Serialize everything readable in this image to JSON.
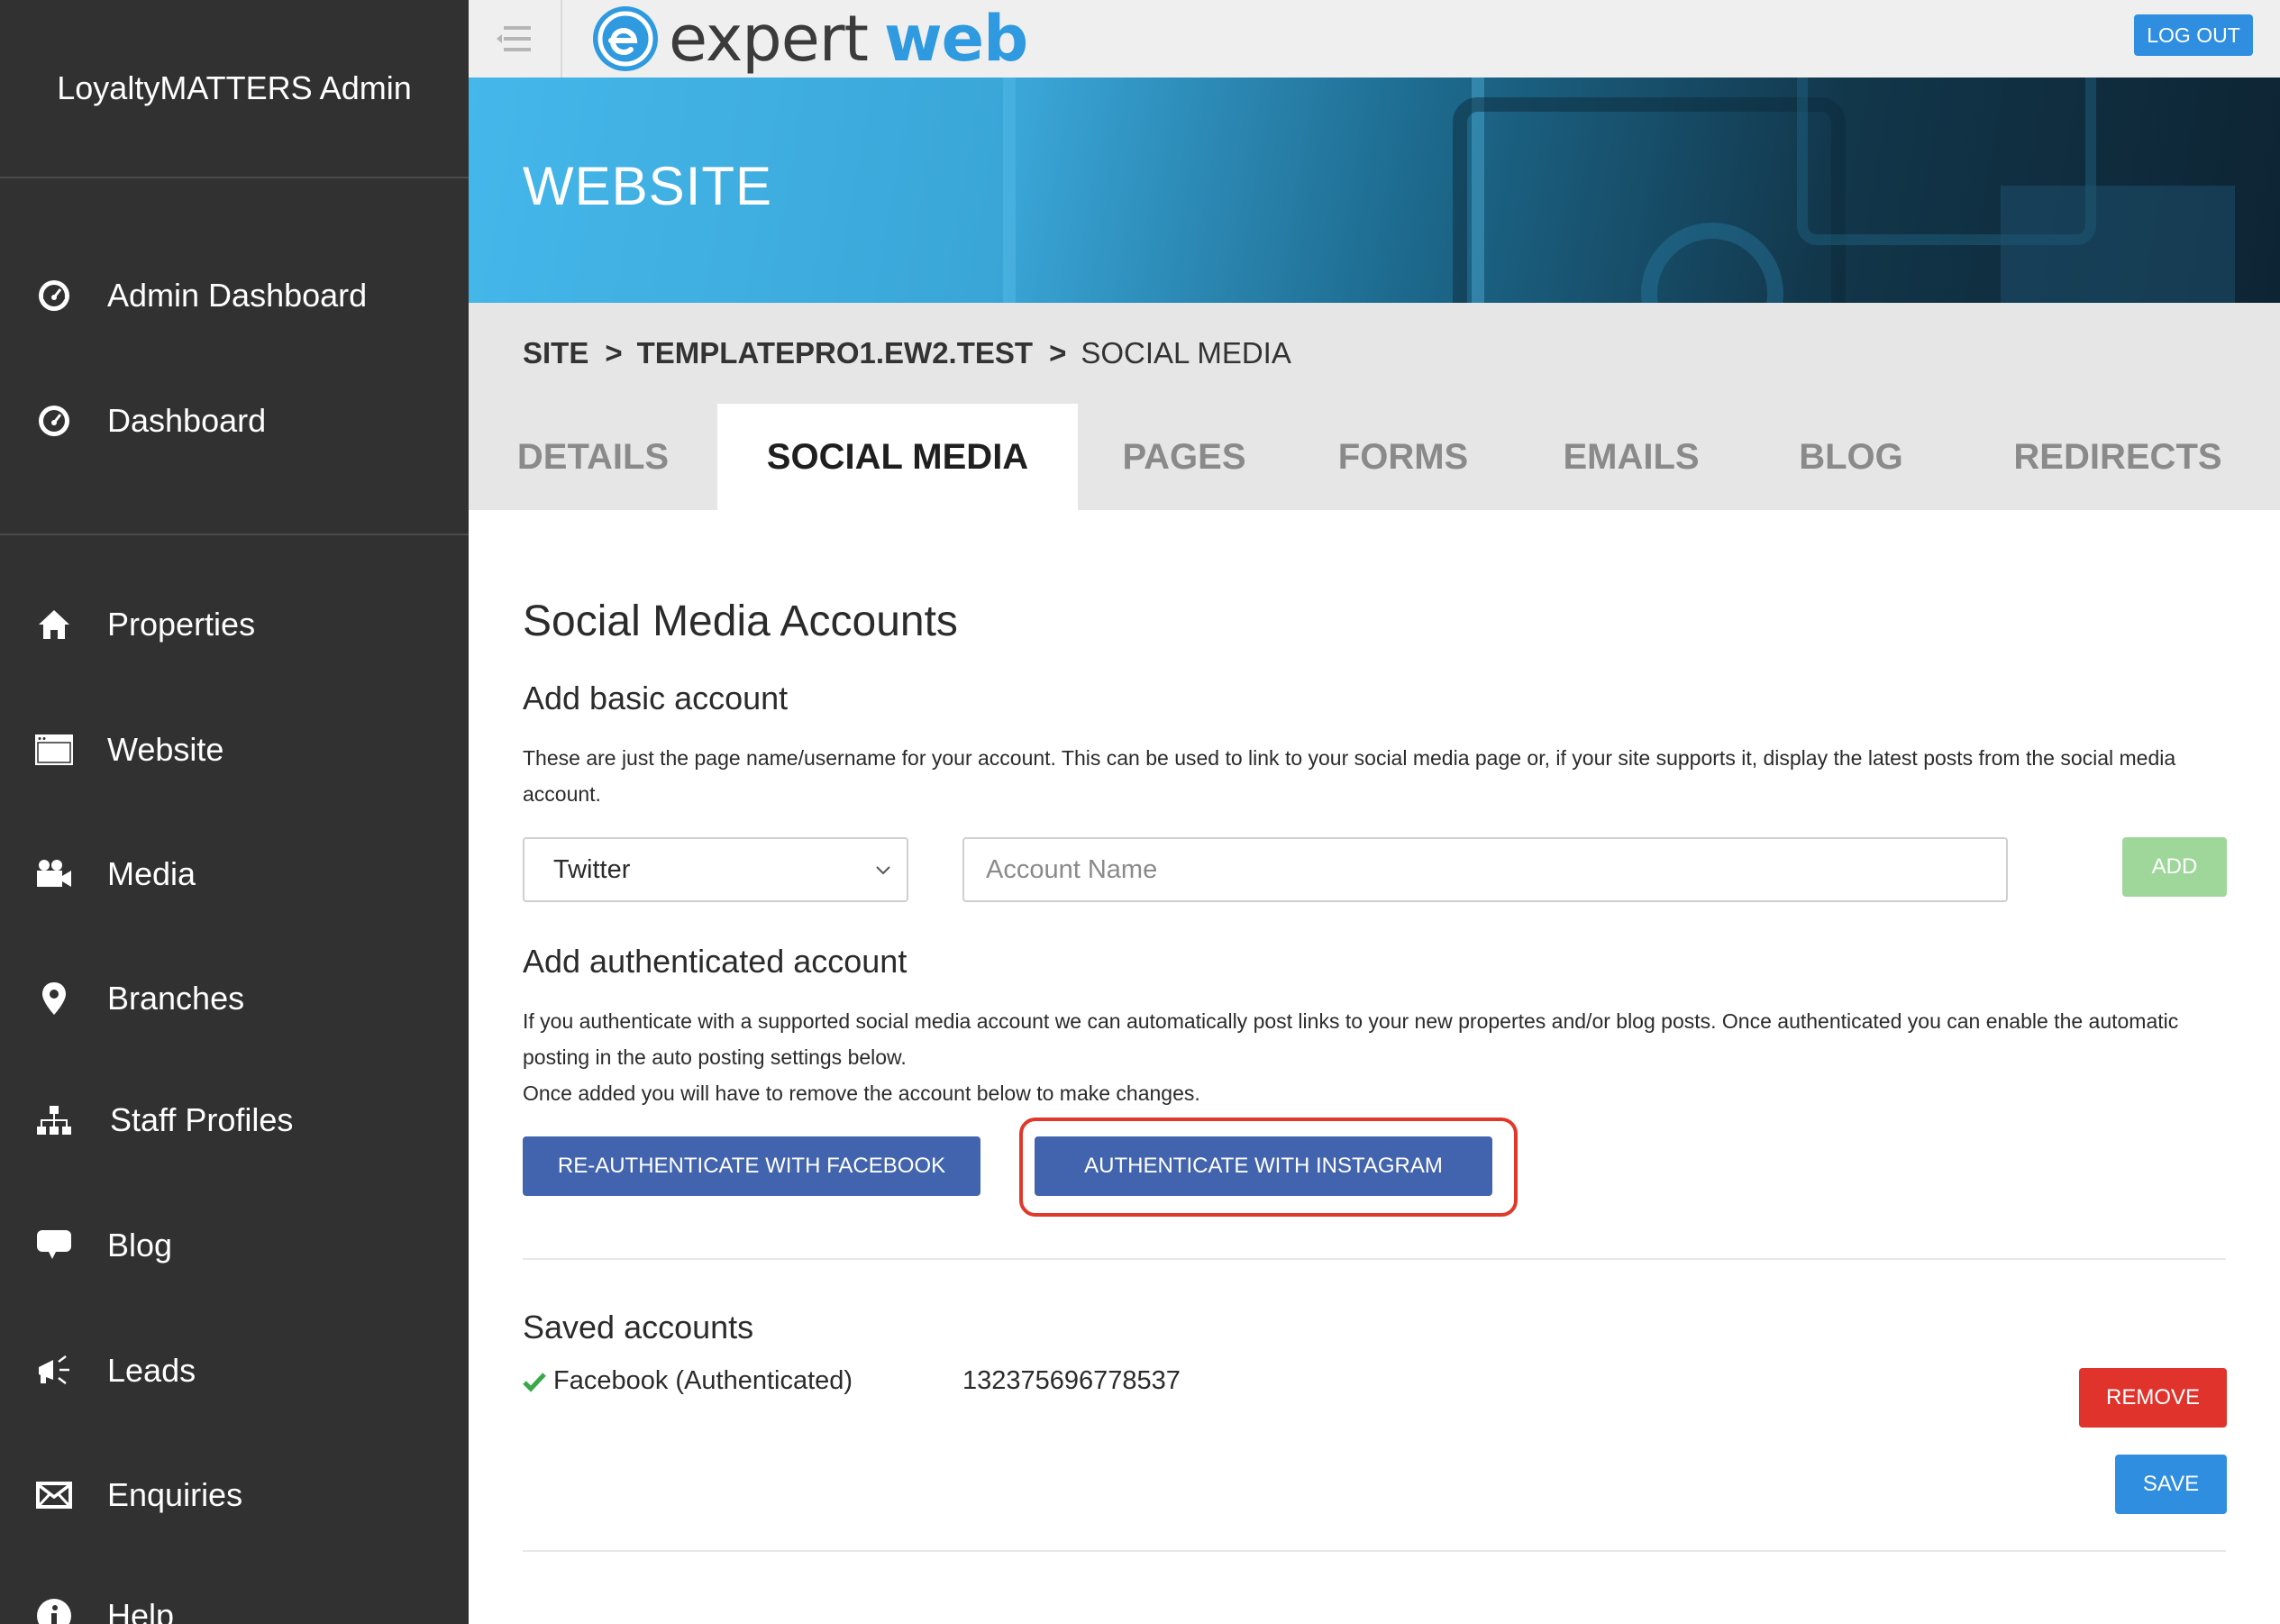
{
  "sidebar": {
    "brand": "LoyaltyMATTERS Admin",
    "items": [
      {
        "label": "Admin Dashboard",
        "icon": "dashboard-gauge-icon"
      },
      {
        "label": "Dashboard",
        "icon": "dashboard-gauge-icon"
      },
      {
        "label": "Properties",
        "icon": "home-icon"
      },
      {
        "label": "Website",
        "icon": "browser-window-icon"
      },
      {
        "label": "Media",
        "icon": "video-camera-icon"
      },
      {
        "label": "Branches",
        "icon": "map-pin-icon"
      },
      {
        "label": "Staff Profiles",
        "icon": "org-chart-icon"
      },
      {
        "label": "Blog",
        "icon": "speech-bubble-icon"
      },
      {
        "label": "Leads",
        "icon": "megaphone-icon"
      },
      {
        "label": "Enquiries",
        "icon": "envelope-icon"
      },
      {
        "label": "Help",
        "icon": "info-icon"
      }
    ]
  },
  "topbar": {
    "logo_word1": "expert",
    "logo_word2": "web",
    "logout_label": "LOG OUT"
  },
  "hero": {
    "title": "WEBSITE"
  },
  "breadcrumb": {
    "site": "SITE",
    "domain": "TEMPLATEPRO1.EW2.TEST",
    "current": "SOCIAL MEDIA",
    "separator": ">"
  },
  "tabs": [
    {
      "label": "DETAILS",
      "active": false
    },
    {
      "label": "SOCIAL MEDIA",
      "active": true
    },
    {
      "label": "PAGES",
      "active": false
    },
    {
      "label": "FORMS",
      "active": false
    },
    {
      "label": "EMAILS",
      "active": false
    },
    {
      "label": "BLOG",
      "active": false
    },
    {
      "label": "REDIRECTS",
      "active": false
    }
  ],
  "main": {
    "title": "Social Media Accounts",
    "basic": {
      "heading": "Add basic account",
      "description": "These are just the page name/username for your account. This can be used to link to your social media page or, if your site supports it, display the latest posts from the social media account.",
      "select_value": "Twitter",
      "account_placeholder": "Account Name",
      "add_label": "ADD"
    },
    "authenticated": {
      "heading": "Add authenticated account",
      "description_1": "If you authenticate with a supported social media account we can automatically post links to your new propertes and/or blog posts. Once authenticated you can enable the automatic posting in the auto posting settings below.",
      "description_2": "Once added you will have to remove the account below to make changes.",
      "facebook_button": "RE-AUTHENTICATE WITH FACEBOOK",
      "instagram_button": "AUTHENTICATE WITH INSTAGRAM"
    },
    "saved": {
      "heading": "Saved accounts",
      "accounts": [
        {
          "name": "Facebook (Authenticated)",
          "id": "132375696778537"
        }
      ],
      "remove_label": "REMOVE",
      "save_label": "SAVE"
    }
  },
  "colors": {
    "sidebar_bg": "#313131",
    "primary_blue": "#2f8ee0",
    "facebook_blue": "#4264ae",
    "add_green": "#9fd79b",
    "remove_red": "#e0332b",
    "highlight_red": "#e0392b",
    "check_green": "#3aa84a"
  }
}
